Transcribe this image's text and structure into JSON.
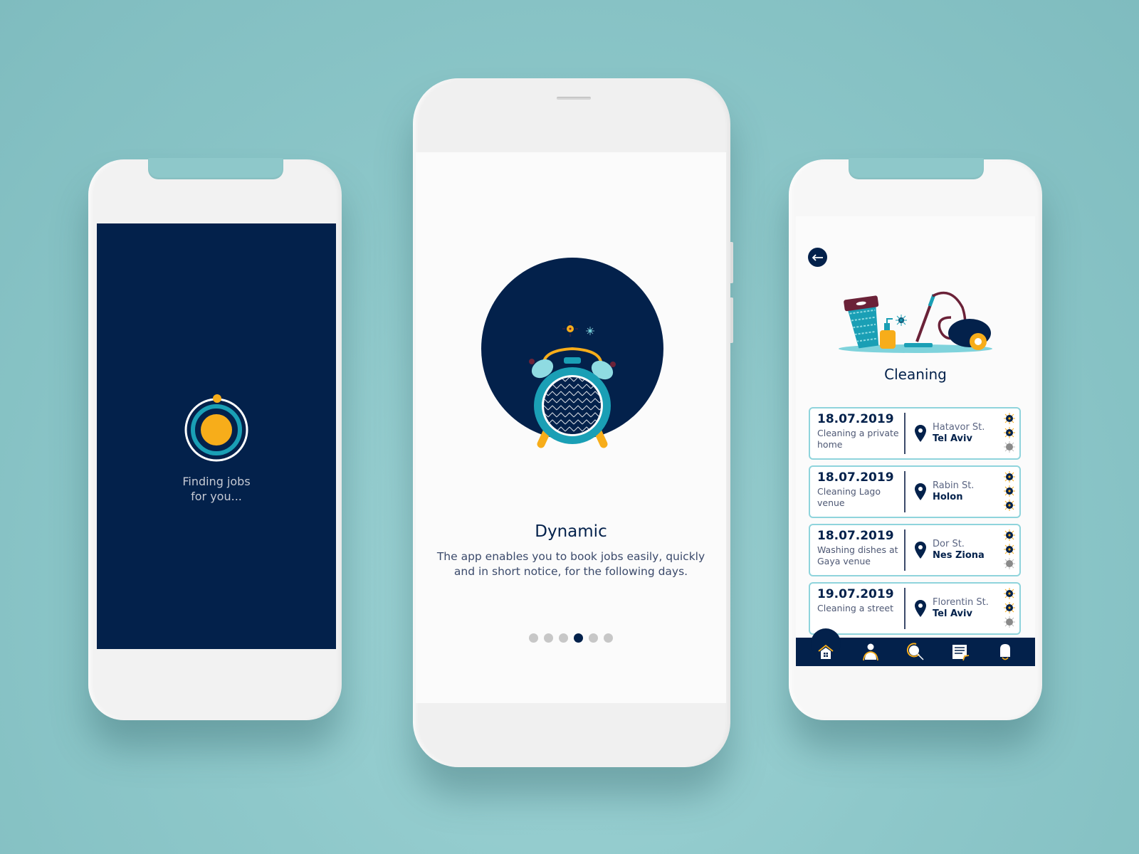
{
  "colors": {
    "navy": "#03214b",
    "teal": "#1a9fb5",
    "light_teal": "#8fd4dc",
    "amber": "#f7ad1a",
    "maroon": "#6b2238",
    "gray_dot": "#c7c7c7",
    "background": "#8ec8ca"
  },
  "left_phone": {
    "screen": "loading",
    "loader_icon": "orbit-loader-icon",
    "loading_text_line1": "Finding jobs",
    "loading_text_line2": "for you..."
  },
  "center_phone": {
    "screen": "onboarding",
    "illustration": "alarm-clock-icon",
    "title": "Dynamic",
    "description_line1": "The app enables you to book jobs easily, quickly",
    "description_line2": "and in short notice, for the following days.",
    "pagination": {
      "total": 6,
      "current": 4
    }
  },
  "right_phone": {
    "screen": "job-list",
    "back_icon": "arrow-left-icon",
    "illustration": "cleaning-supplies-icon",
    "category_title": "Cleaning",
    "jobs": [
      {
        "date": "18.07.2019",
        "desc_line1": "Cleaning a private",
        "desc_line2": "home",
        "street": "Hatavor St.",
        "city": "Tel Aviv",
        "rating": 2,
        "rating_max": 3
      },
      {
        "date": "18.07.2019",
        "desc_line1": "Cleaning Lago",
        "desc_line2": "venue",
        "street": "Rabin St.",
        "city": "Holon",
        "rating": 3,
        "rating_max": 3
      },
      {
        "date": "18.07.2019",
        "desc_line1": "Washing dishes at",
        "desc_line2": "Gaya venue",
        "street": "Dor St.",
        "city": "Nes Ziona",
        "rating": 2,
        "rating_max": 3
      },
      {
        "date": "19.07.2019",
        "desc_line1": "Cleaning a street",
        "desc_line2": "",
        "street": "Florentin St.",
        "city": "Tel Aviv",
        "rating": 2,
        "rating_max": 3
      }
    ],
    "tabbar": [
      {
        "icon": "home-icon",
        "active": true
      },
      {
        "icon": "profile-icon",
        "active": false
      },
      {
        "icon": "search-icon",
        "active": false
      },
      {
        "icon": "document-icon",
        "active": false
      },
      {
        "icon": "bell-icon",
        "active": false
      }
    ]
  }
}
